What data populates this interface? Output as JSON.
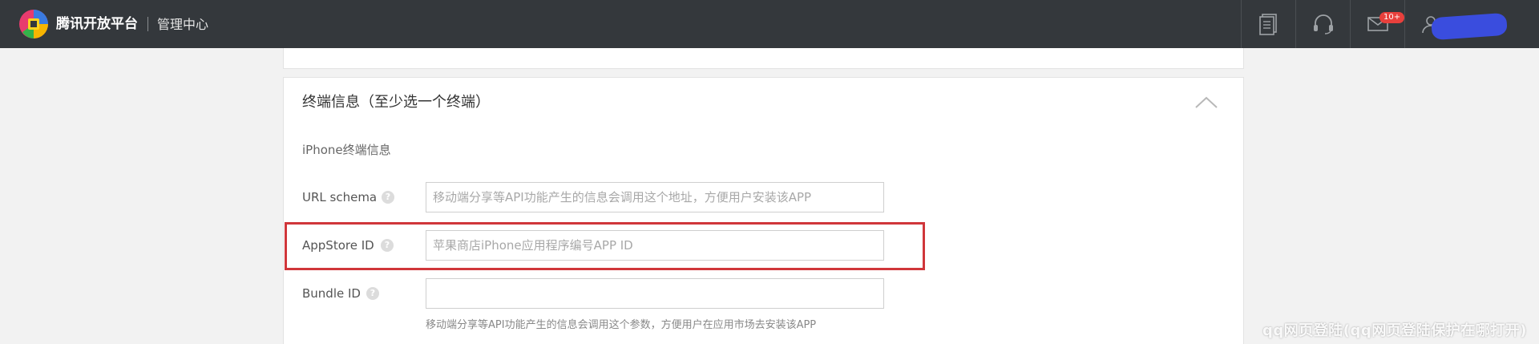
{
  "header": {
    "brand": "腾讯开放平台",
    "section": "管理中心",
    "icons": [
      "document-icon",
      "headset-icon",
      "mail-icon",
      "user-icon"
    ],
    "mail_badge": "10+",
    "colors": {
      "bar": "#34383c",
      "badge": "#e8403c"
    }
  },
  "section": {
    "title": "终端信息（至少选一个终端）",
    "subtitle": "iPhone终端信息",
    "fields": [
      {
        "label": "URL schema",
        "value": "",
        "placeholder": "移动端分享等API功能产生的信息会调用这个地址，方便用户安装该APP"
      },
      {
        "label": "AppStore ID",
        "value": "",
        "placeholder": "苹果商店iPhone应用程序编号APP ID"
      },
      {
        "label": "Bundle ID",
        "value": "",
        "placeholder": ""
      }
    ],
    "bundle_hint": "移动端分享等API功能产生的信息会调用这个参数，方便用户在应用市场去安装该APP",
    "help_glyph": "?",
    "highlight_color": "#d0363a"
  },
  "watermark": "qq网页登陆(qq网页登陆保护在哪打开)"
}
